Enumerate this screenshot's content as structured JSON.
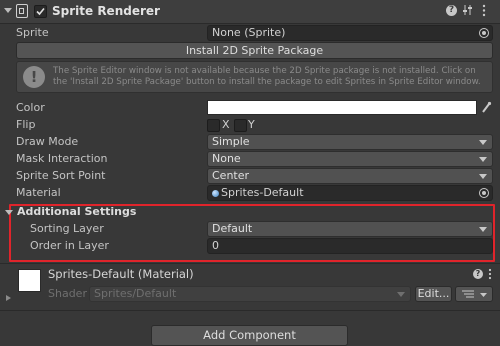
{
  "header": {
    "title": "Sprite Renderer",
    "enabled": true,
    "help_icon": "help-icon",
    "preset_icon": "preset-icon",
    "menu_icon": "kebab-menu-icon"
  },
  "fields": {
    "sprite": {
      "label": "Sprite",
      "value": "None (Sprite)"
    },
    "install_button": "Install 2D Sprite Package",
    "warning": "The Sprite Editor window is not available because the 2D Sprite package is not installed. Click on the 'Install 2D Sprite Package' button to install the package to edit Sprites in Sprite Editor window.",
    "color": {
      "label": "Color",
      "value": "#ffffff"
    },
    "flip": {
      "label": "Flip",
      "x": "X",
      "y": "Y",
      "x_checked": false,
      "y_checked": false
    },
    "draw_mode": {
      "label": "Draw Mode",
      "value": "Simple"
    },
    "mask_interaction": {
      "label": "Mask Interaction",
      "value": "None"
    },
    "sprite_sort_point": {
      "label": "Sprite Sort Point",
      "value": "Center"
    },
    "material": {
      "label": "Material",
      "value": "Sprites-Default"
    }
  },
  "additional_settings": {
    "title": "Additional Settings",
    "sorting_layer": {
      "label": "Sorting Layer",
      "value": "Default"
    },
    "order_in_layer": {
      "label": "Order in Layer",
      "value": "0"
    },
    "highlight_color": "#e0242b"
  },
  "material_section": {
    "title": "Sprites-Default (Material)",
    "shader_label": "Shader",
    "shader_value": "Sprites/Default",
    "edit_button": "Edit..."
  },
  "add_component": "Add Component"
}
